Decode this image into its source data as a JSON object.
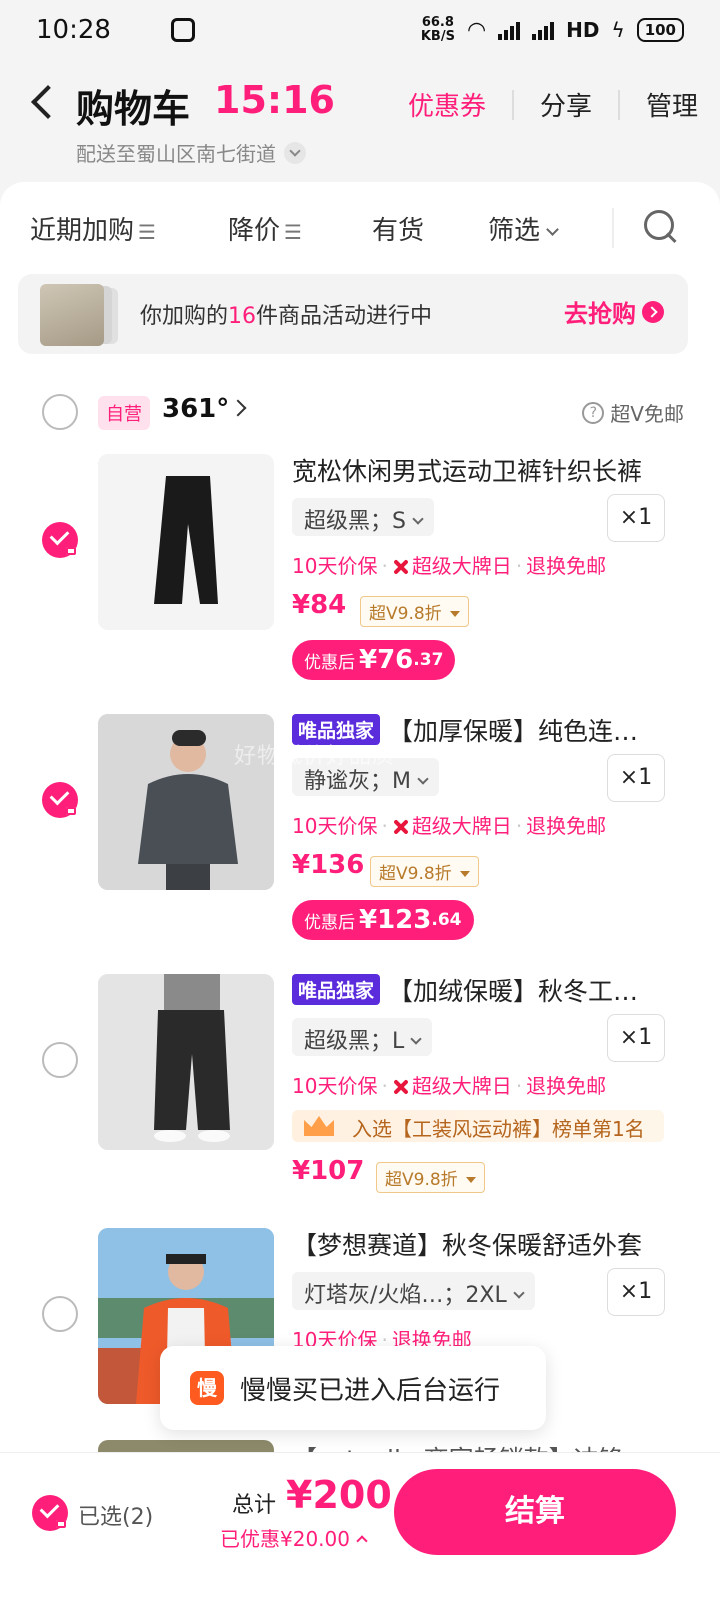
{
  "status": {
    "time": "10:28",
    "net_speed_top": "66.8",
    "net_speed_unit": "KB/S",
    "hd": "HD",
    "battery": "100"
  },
  "header": {
    "title": "购物车",
    "countdown": "15:16",
    "address": "配送至蜀山区南七街道",
    "coupon": "优惠券",
    "share": "分享",
    "manage": "管理"
  },
  "filters": {
    "recent": "近期加购",
    "price_drop": "降价",
    "in_stock": "有货",
    "filter": "筛选"
  },
  "promo": {
    "text_a": "你加购的",
    "count": "16",
    "text_b": "件商品活动进行中",
    "cta": "去抢购"
  },
  "store": {
    "badge": "自营",
    "name": "361°",
    "perk": "超V免邮"
  },
  "items": [
    {
      "name": "宽松休闲男式运动卫裤针织长裤",
      "spec": "超级黑；S",
      "qty": "×1",
      "tag1": "10天价保",
      "tag2": "超级大牌日",
      "tag3": "退换免邮",
      "price": "¥84",
      "vip": "超V9.8折",
      "after_label": "优惠后",
      "after_val": "¥76",
      "after_cents": ".37"
    },
    {
      "exclusive": "唯品独家",
      "name": "【加厚保暖】纯色连帽羽绒服",
      "spec": "静谧灰；M",
      "qty": "×1",
      "tag1": "10天价保",
      "tag2": "超级大牌日",
      "tag3": "退换免邮",
      "price": "¥136",
      "vip": "超V9.8折",
      "after_label": "优惠后",
      "after_val": "¥123",
      "after_cents": ".64",
      "watermark": "好物低价好品质"
    },
    {
      "exclusive": "唯品独家",
      "name": "【加绒保暖】秋冬工装运动裤",
      "spec": "超级黑；L",
      "qty": "×1",
      "tag1": "10天价保",
      "tag2": "超级大牌日",
      "tag3": "退换免邮",
      "rank": "入选【工装风运动裤】榜单第1名",
      "price": "¥107",
      "vip": "超V9.8折"
    },
    {
      "name": "【梦想赛道】秋冬保暖舒适外套",
      "spec": "灯塔灰/火焰…；2XL",
      "qty": "×1",
      "tag1": "10天价保",
      "tag3": "退换免邮"
    },
    {
      "name": "【actually 商家畅销款】冲锋衣防风"
    }
  ],
  "toast": {
    "icon": "慢",
    "text": "慢慢买已进入后台运行"
  },
  "bottom": {
    "selected": "已选(2)",
    "total_label": "总计",
    "total_value": "¥200",
    "saved": "已优惠¥20.00",
    "checkout": "结算"
  }
}
